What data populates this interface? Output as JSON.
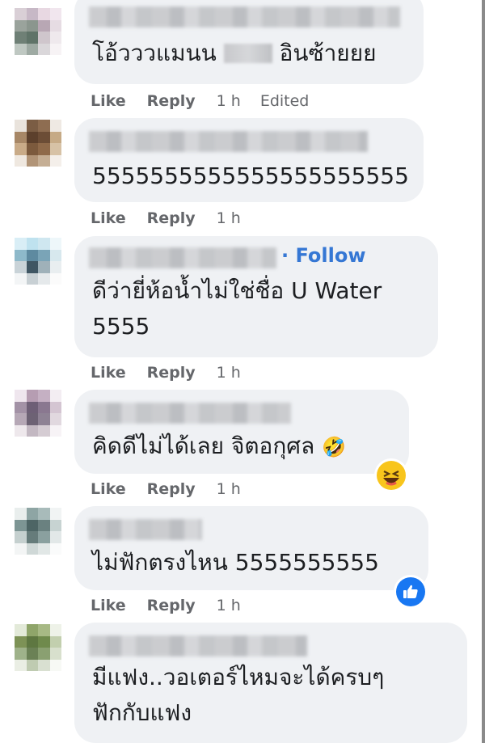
{
  "comments": [
    {
      "text_parts": [
        "โอ้วววแมนน ",
        " อินซ้ายยย"
      ],
      "like": "Like",
      "reply": "Reply",
      "time": "1 h",
      "edited": "Edited"
    },
    {
      "text": "5555555555555555555555",
      "like": "Like",
      "reply": "Reply",
      "time": "1 h"
    },
    {
      "follow": "Follow",
      "text": "ดีว่ายี่ห้อน้ำไม่ใช่ชื่อ U Water\n5555",
      "like": "Like",
      "reply": "Reply",
      "time": "1 h"
    },
    {
      "text": "คิดดีไม่ได้เลย จิตอกุศล",
      "emoji": "🤣",
      "like": "Like",
      "reply": "Reply",
      "time": "1 h",
      "reaction": "laugh"
    },
    {
      "text": "ไม่ฟักตรงไหน 5555555555",
      "like": "Like",
      "reply": "Reply",
      "time": "1 h",
      "reaction": "like"
    },
    {
      "text": "มีแฟง..วอเตอร์ไหมจะได้ครบๆ\nฟักกับแฟง"
    }
  ],
  "colors": {
    "bubble": "#eff1f4",
    "meta": "#65676b",
    "follow": "#3577d4",
    "like_reaction": "#1877f2",
    "laugh_reaction": "#f8c51c"
  }
}
